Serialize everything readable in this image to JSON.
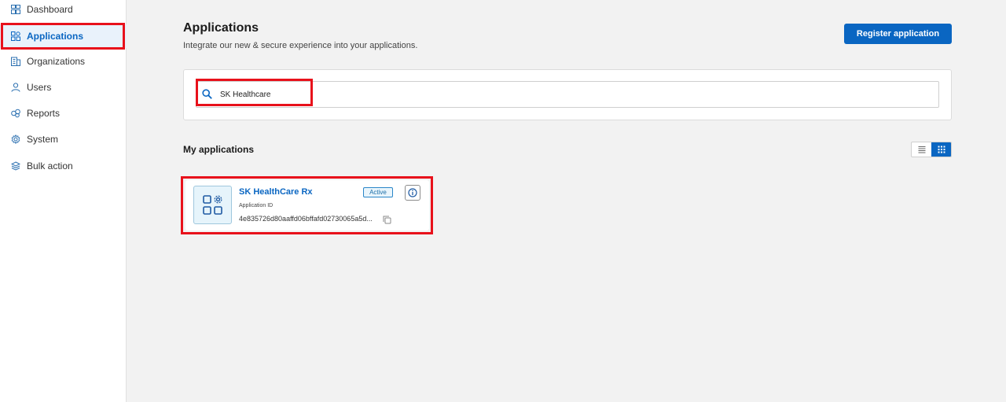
{
  "sidebar": {
    "items": [
      {
        "label": "Dashboard",
        "icon": "dashboard-icon",
        "active": false
      },
      {
        "label": "Applications",
        "icon": "applications-icon",
        "active": true
      },
      {
        "label": "Organizations",
        "icon": "organizations-icon",
        "active": false
      },
      {
        "label": "Users",
        "icon": "user-icon",
        "active": false
      },
      {
        "label": "Reports",
        "icon": "reports-icon",
        "active": false
      },
      {
        "label": "System",
        "icon": "gear-icon",
        "active": false
      },
      {
        "label": "Bulk action",
        "icon": "layers-icon",
        "active": false
      }
    ]
  },
  "header": {
    "title": "Applications",
    "subtitle": "Integrate our new & secure experience into your applications.",
    "register_button_label": "Register application"
  },
  "search": {
    "value": "SK Healthcare",
    "icon": "search-icon"
  },
  "section": {
    "title": "My applications",
    "view_mode": "grid"
  },
  "applications": [
    {
      "name": "SK HealthCare Rx",
      "status": "Active",
      "id_label": "Application ID",
      "id_value": "4e835726d80aaffd06bffafd02730065a5d..."
    }
  ],
  "colors": {
    "accent": "#0a66c2",
    "highlight": "#e8111b",
    "background": "#f2f2f2"
  }
}
